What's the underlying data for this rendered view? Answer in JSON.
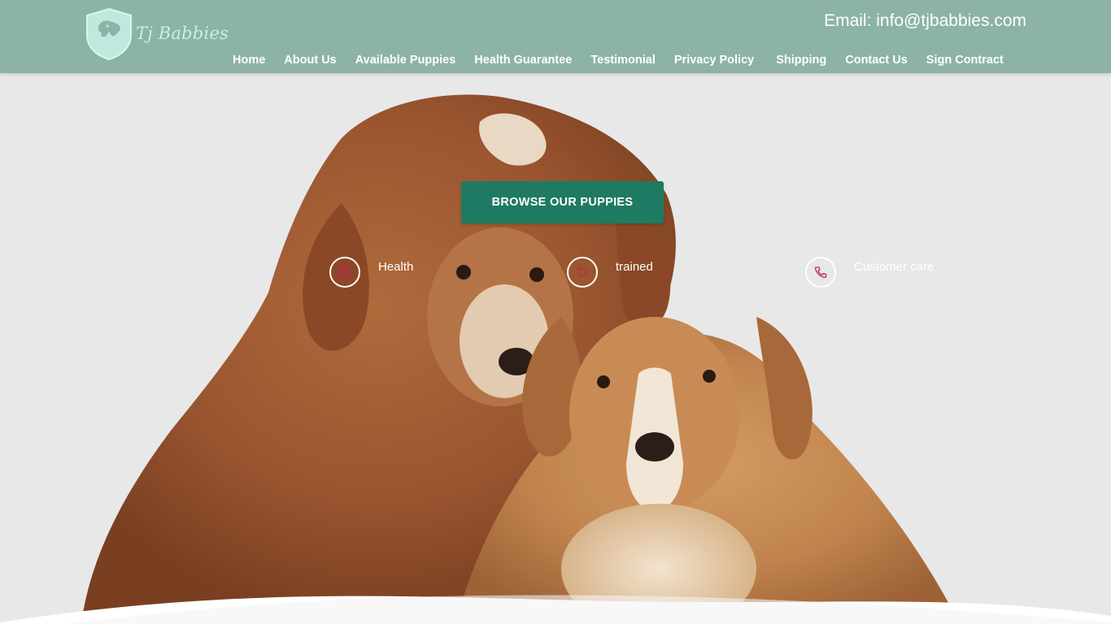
{
  "brand": {
    "name": "Tj Babbies"
  },
  "header": {
    "email": "Email: info@tjbabbies.com"
  },
  "nav": {
    "items": [
      {
        "label": "Home"
      },
      {
        "label": "About Us"
      },
      {
        "label": "Available Puppies"
      },
      {
        "label": "Health Guarantee"
      },
      {
        "label": "Testimonial"
      },
      {
        "label": "Privacy Policy"
      },
      {
        "label": "Shipping"
      },
      {
        "label": "Contact Us"
      },
      {
        "label": "Sign Contract"
      }
    ]
  },
  "hero": {
    "cta_label": "BROWSE OUR PUPPIES",
    "features": [
      {
        "label": "Health",
        "icon": "health-book-icon"
      },
      {
        "label": "trained",
        "icon": "refresh-icon"
      },
      {
        "label": "Customer care",
        "icon": "phone-icon"
      }
    ]
  },
  "colors": {
    "header_bg": "#8cb3a6",
    "cta_bg": "#1e7a62",
    "icon_accent": "#c0284e",
    "hero_bg": "#e8e8e8"
  }
}
